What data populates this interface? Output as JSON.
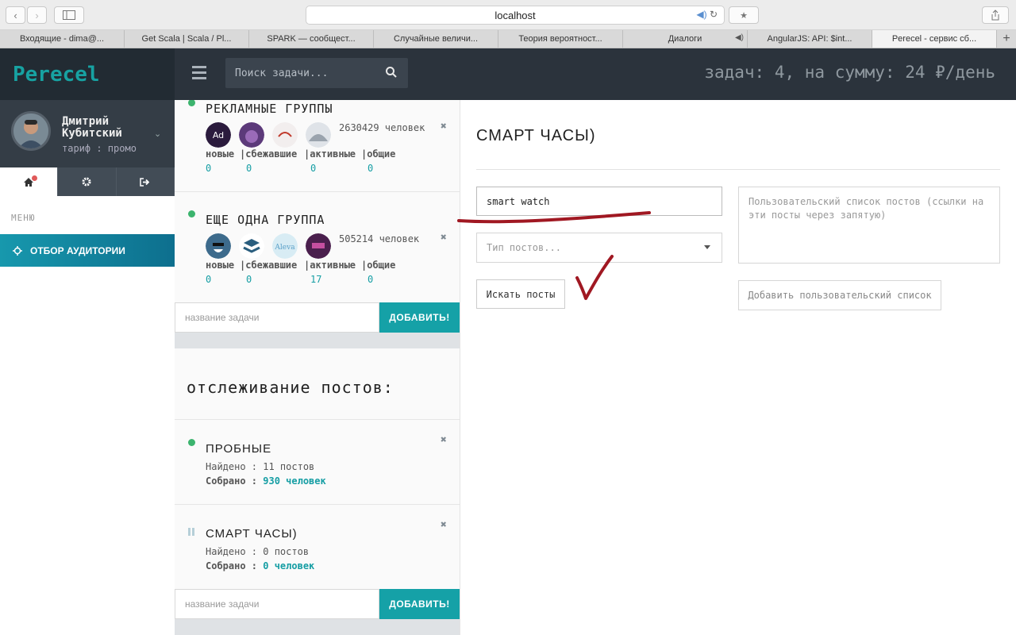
{
  "browser": {
    "url": "localhost",
    "tabs": [
      {
        "label": "Входящие - dima@...",
        "active": false
      },
      {
        "label": "Get Scala | Scala / Pl...",
        "active": false
      },
      {
        "label": "SPARK — сообщест...",
        "active": false
      },
      {
        "label": "Случайные величи...",
        "active": false
      },
      {
        "label": "Теория вероятност...",
        "active": false
      },
      {
        "label": "Диалоги",
        "active": false,
        "audio": true
      },
      {
        "label": "AngularJS: API: $int...",
        "active": false
      },
      {
        "label": "Perecel - сервис сб...",
        "active": true
      }
    ],
    "new_tab": "+"
  },
  "app": {
    "brand": "Perecel",
    "search_placeholder": "Поиск задачи...",
    "summary": "задач: 4, на сумму: 24 ₽/день",
    "accent": "#15a1a7"
  },
  "user": {
    "name": "Дмитрий Кубитский",
    "tariff": "тариф : промо"
  },
  "sidebar": {
    "menu_label": "МЕНЮ",
    "menu_item": "ОТБОР АУДИТОРИИ",
    "tabs": [
      "home-icon",
      "gear-icon",
      "logout-icon"
    ]
  },
  "groups": [
    {
      "title": "РЕКЛАМНЫЕ ГРУППЫ",
      "count": "2630429 человек",
      "stats": [
        {
          "label": "новые",
          "value": "0"
        },
        {
          "label": "|сбежавшие",
          "value": "0"
        },
        {
          "label": "|активные",
          "value": "0"
        },
        {
          "label": "|общие",
          "value": "0"
        }
      ]
    },
    {
      "title": "ЕЩЕ ОДНА ГРУППА",
      "count": "505214 человек",
      "stats": [
        {
          "label": "новые",
          "value": "0"
        },
        {
          "label": "|сбежавшие",
          "value": "0"
        },
        {
          "label": "|активные",
          "value": "17"
        },
        {
          "label": "|общие",
          "value": "0"
        }
      ]
    }
  ],
  "add_task": {
    "placeholder": "название задачи",
    "button": "ДОБАВИТЬ!"
  },
  "posts_section": {
    "heading": "отслеживание постов:",
    "items": [
      {
        "title": "ПРОБНЫЕ",
        "found_label": "Найдено : ",
        "found_value": "11 постов",
        "collected_label": "Собрано : ",
        "collected_value": "930 человек",
        "status": "active"
      },
      {
        "title": "СМАРТ ЧАСЫ)",
        "found_label": "Найдено : ",
        "found_value": "0 постов",
        "collected_label": "Собрано : ",
        "collected_value": "0 человек",
        "status": "paused"
      }
    ]
  },
  "detail": {
    "title": "СМАРТ ЧАСЫ)",
    "keyword_value": "smart watch",
    "post_type_placeholder": "Тип постов...",
    "find_button": "Искать посты",
    "custom_list_placeholder": "Пользовательский список постов (ссылки на эти посты через запятую)",
    "add_list_button": "Добавить пользовательский список"
  }
}
